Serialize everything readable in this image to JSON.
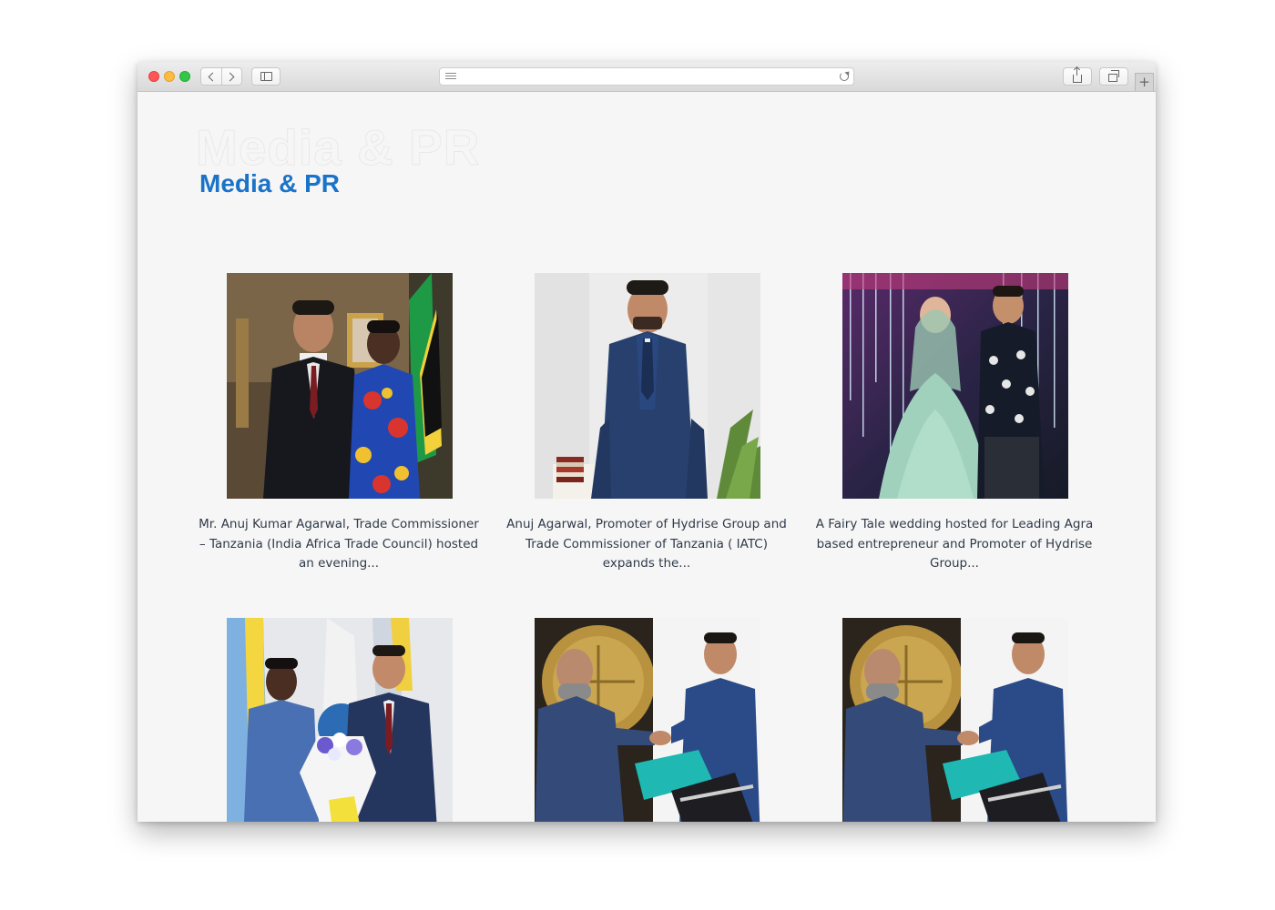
{
  "section": {
    "background_title": "Media & PR",
    "title": "Media & PR"
  },
  "media_items": [
    {
      "caption": "Mr. Anuj Kumar Agarwal, Trade Commissioner – Tanzania (India Africa Trade Council) hosted an evening..."
    },
    {
      "caption": "Anuj Agarwal, Promoter of Hydrise Group and Trade Commissioner of Tanzania ( IATC) expands the..."
    },
    {
      "caption": "A Fairy Tale wedding hosted for Leading Agra based entrepreneur and Promoter of Hydrise Group..."
    },
    {
      "caption": ""
    },
    {
      "caption": ""
    },
    {
      "caption": ""
    }
  ],
  "colors": {
    "accent": "#1a73c8",
    "caption_text": "#2f3a48",
    "page_background": "#f6f6f6"
  }
}
